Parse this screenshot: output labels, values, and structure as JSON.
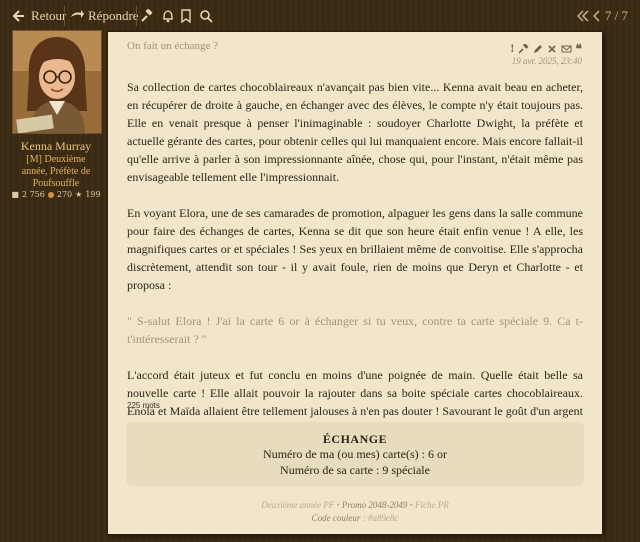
{
  "topbar": {
    "back_label": "Retour",
    "reply_label": "Répondre",
    "pager_text": "7 / 7"
  },
  "author": {
    "name": "Kenna Murray",
    "title_line1": "[M] Deuxième",
    "title_line2": "année, Préfète de",
    "title_line3": "Poufsouffle",
    "stat_messages": "2 756",
    "stat_points": "270",
    "stat_other": "199"
  },
  "post": {
    "title": "On fait un échange ?",
    "date": "19 avr. 2025, 23:40",
    "paragraph1": "Sa collection de cartes chocoblaireaux n'avançait pas bien vite... Kenna avait beau en acheter, en récupérer de droite à gauche, en échanger avec des élèves, le compte n'y était toujours pas. Elle en venait presque à penser l'inimaginable : soudoyer Charlotte Dwight, la préfète et actuelle gérante des cartes, pour obtenir celles qui lui manquaient encore. Mais encore fallait-il qu'elle arrive à parler à son impressionnante aînée, chose qui, pour l'instant, n'était même pas envisageable tellement elle l'impressionnait.",
    "paragraph2": "En voyant Elora, une de ses camarades de promotion, alpaguer les gens dans la salle commune pour faire des échanges de cartes, Kenna se dit que son heure était enfin venue ! A elle, les magnifiques cartes or et spéciales ! Ses yeux en brillaient même de convoitise. Elle s'approcha discrètement, attendit son tour - il y avait foule, rien de moins que Deryn et Charlotte - et proposa :",
    "quote": "\" S-salut Elora ! J'ai la carte 6 or à échanger si tu veux, contre ta carte spéciale 9. Ca t-t'intéresserait ? \"",
    "paragraph3": "L'accord était juteux et fut conclu en moins d'une poignée de main. Quelle était belle sa nouvelle carte ! Elle allait pouvoir la rajouter dans sa boite spéciale cartes chocoblaireaux. Enola et Maïda allaient être tellement jalouses à n'en pas douter ! Savourant le goût d'un argent savamment dépensé, Kenna retourna dans son dortoir.",
    "word_count": "225 mots"
  },
  "exchange": {
    "title": "ÉCHANGE",
    "line1": "Numéro de ma (ou mes) carte(s) : 6 or",
    "line2": "Numéro de sa carte : 9 spéciale"
  },
  "signature": {
    "part1": "Deuxième année PF",
    "sep": " • ",
    "part2": "Promo 2048-2049",
    "part3": "Fiche PR",
    "line2_label": "Code couleur",
    "line2_value": " : #a89e8c"
  },
  "colors": {
    "page_bg": "#3a2a14",
    "post_bg": "#f1e6c9",
    "author_name": "#e9c47a"
  }
}
